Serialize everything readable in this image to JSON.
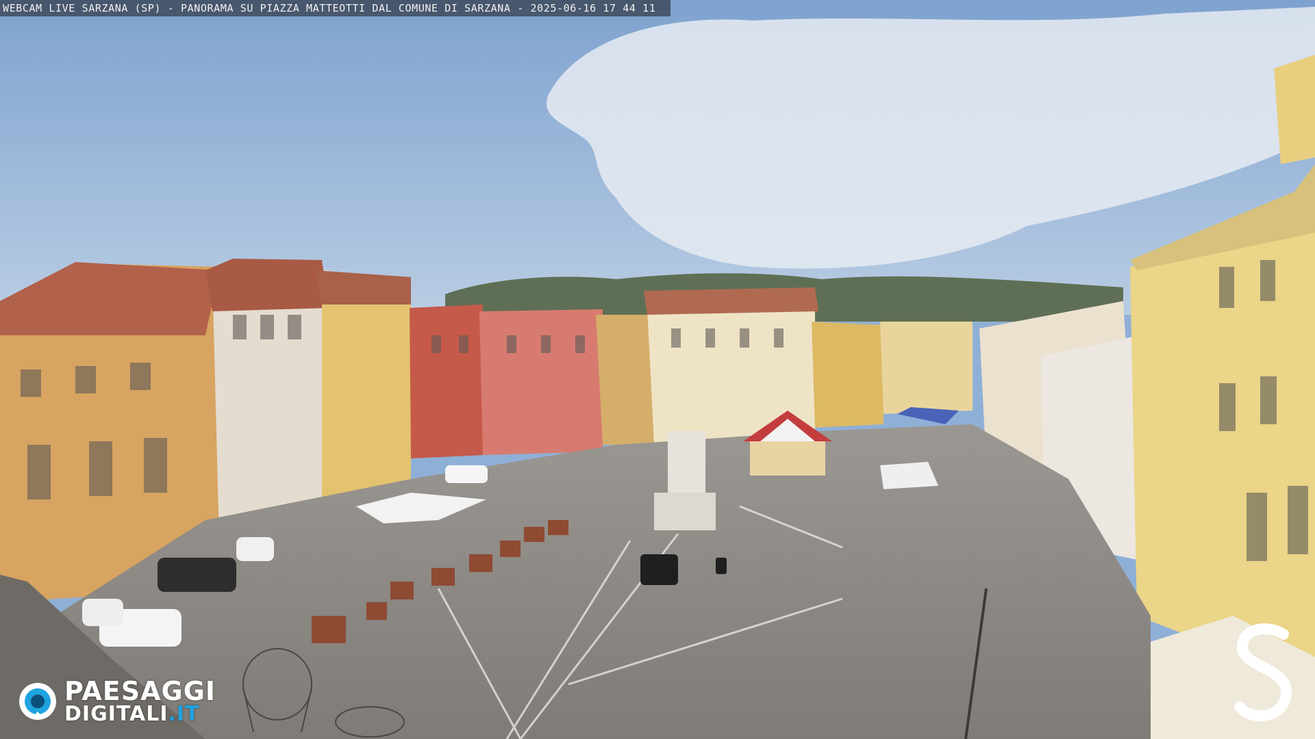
{
  "overlay": {
    "caption": "WEBCAM LIVE SARZANA (SP) - PANORAMA SU PIAZZA MATTEOTTI DAL COMUNE DI SARZANA - 2025-06-16  17 44 11"
  },
  "watermark": {
    "brand_line1": "PAESAGGI",
    "brand_line2_main": "DIGITALI",
    "brand_line2_suffix": ".IT",
    "brand_accent_color": "#1fa3e0",
    "corner_logo_letter": "S"
  },
  "scene": {
    "description_icon": "town-square-panorama-icon",
    "sky_color": "#8fb0d6",
    "pavement_color": "#8e8a86"
  }
}
